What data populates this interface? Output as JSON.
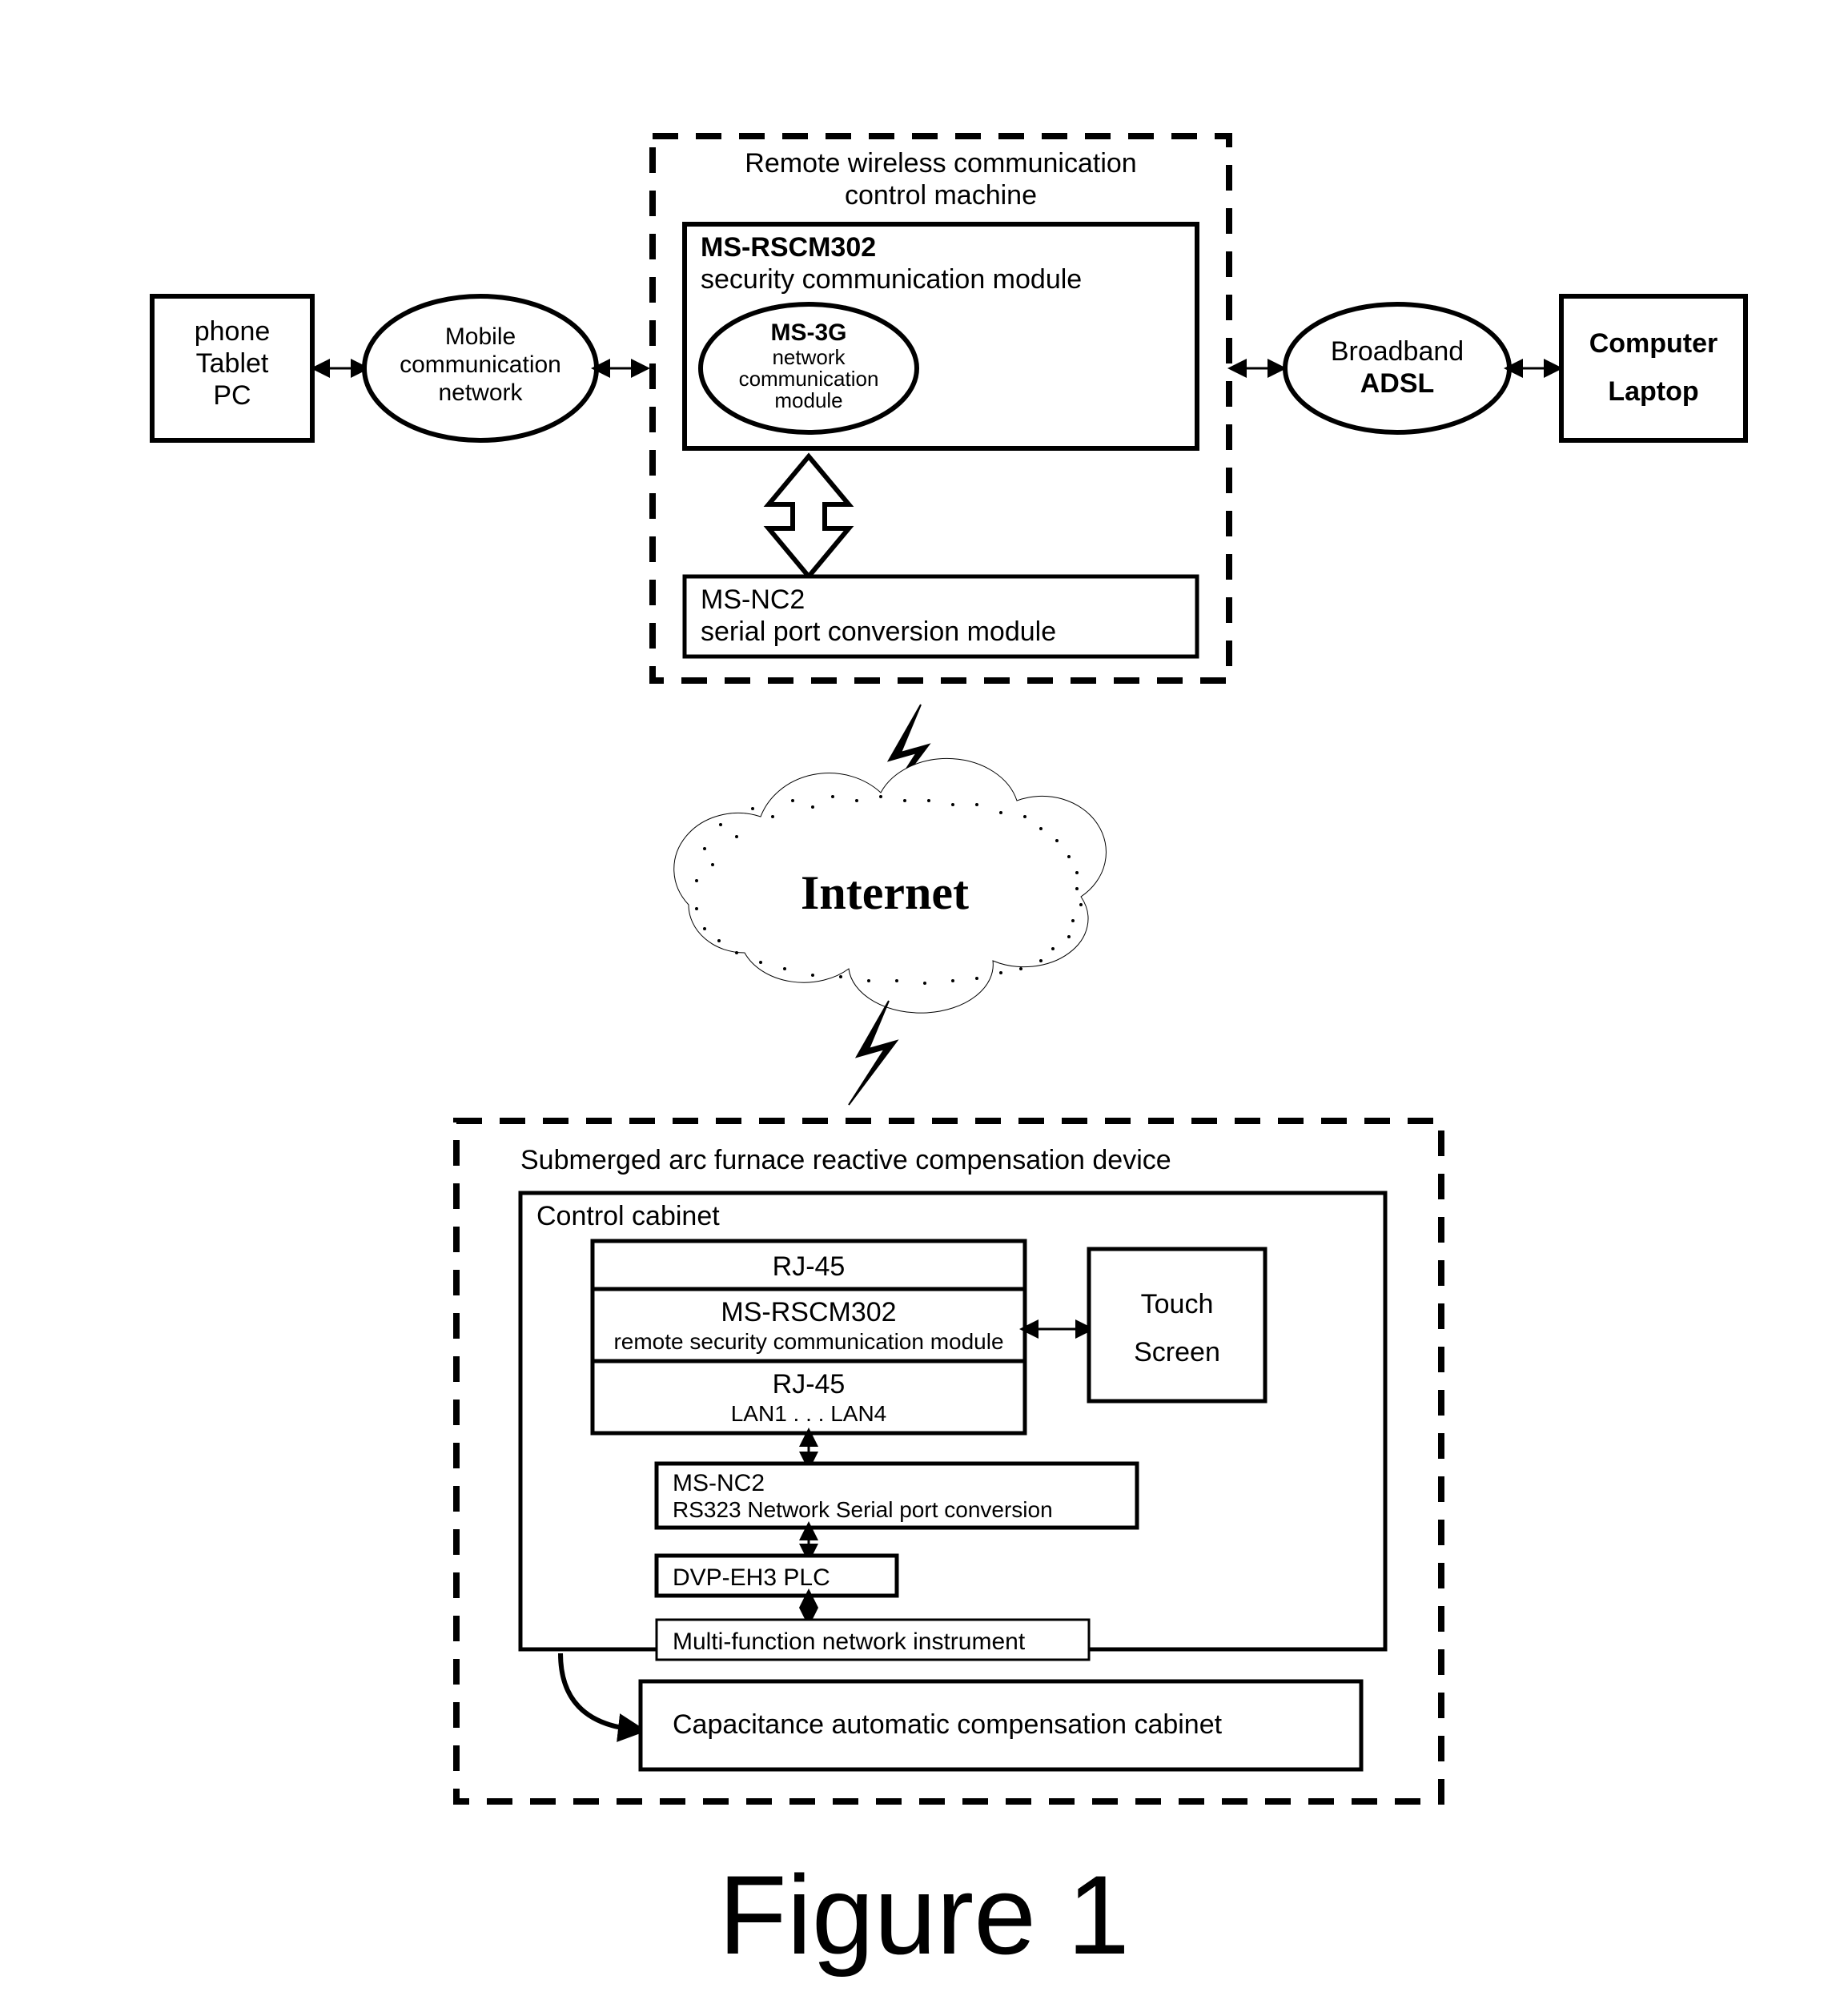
{
  "phone": {
    "l1": "phone",
    "l2": "Tablet",
    "l3": "PC"
  },
  "mobile": {
    "l1": "Mobile",
    "l2": "communication",
    "l3": "network"
  },
  "rwcm": {
    "title1": "Remote wireless communication",
    "title2": "control machine"
  },
  "rscm": {
    "name": "MS-RSCM302",
    "desc": "security communication module"
  },
  "ms3g": {
    "name": "MS-3G",
    "l1": "network",
    "l2": "communication",
    "l3": "module"
  },
  "nc2top": {
    "name": "MS-NC2",
    "desc": "serial port conversion module"
  },
  "adsl": {
    "l1": "Broadband",
    "l2": "ADSL"
  },
  "computer": {
    "l1": "Computer",
    "l2": "Laptop"
  },
  "internet": "Internet",
  "saf": {
    "title": "Submerged arc furnace reactive compensation device"
  },
  "cc": {
    "title": "Control cabinet"
  },
  "rj45a": "RJ-45",
  "rscm2": {
    "name": "MS-RSCM302",
    "desc": "remote security communication module"
  },
  "rj45b": {
    "name": "RJ-45",
    "lan": "LAN1 .   .   . LAN4"
  },
  "touch": {
    "l1": "Touch",
    "l2": "Screen"
  },
  "nc2": {
    "name": "MS-NC2",
    "desc": "RS323 Network Serial port conversion"
  },
  "plc": "DVP-EH3 PLC",
  "mfni": "Multi-function network instrument",
  "cac": "Capacitance automatic compensation cabinet",
  "caption": "Figure 1"
}
